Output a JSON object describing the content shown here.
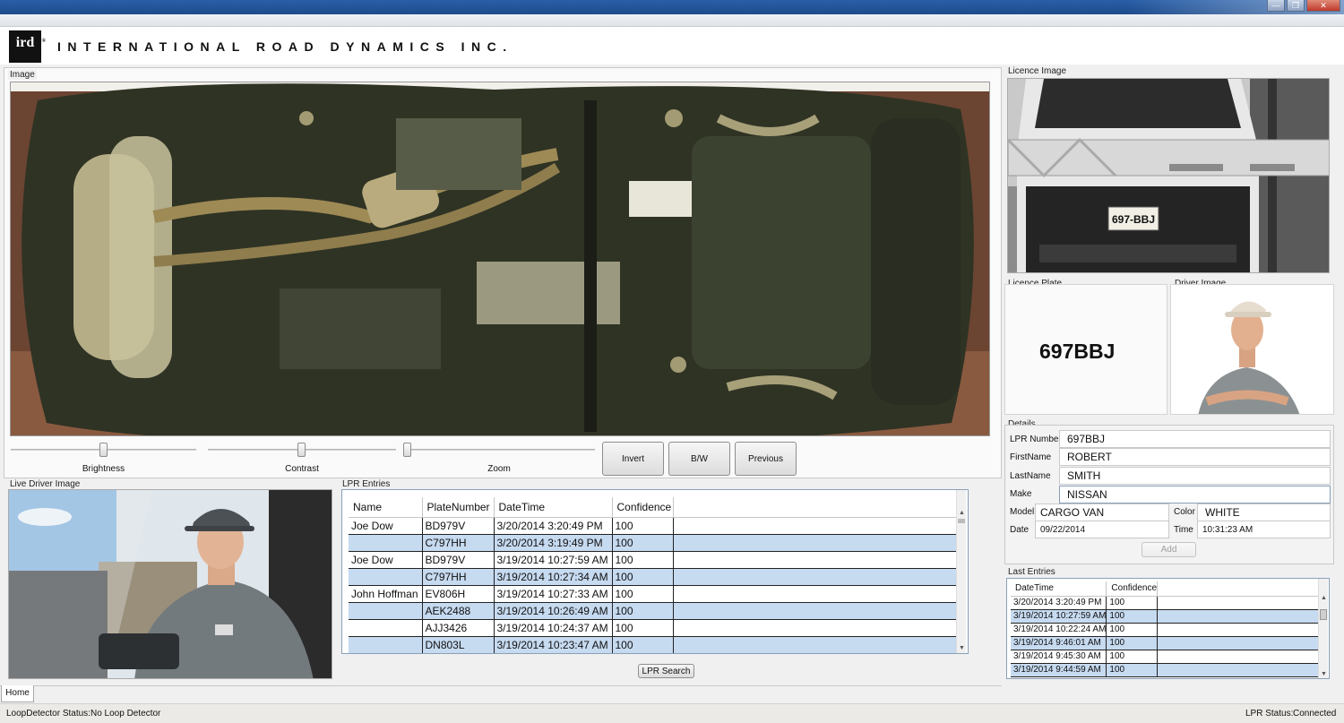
{
  "window": {
    "min": "—",
    "max": "❐",
    "close": "✕"
  },
  "header": {
    "logo_text": "ird",
    "logo_reg": "®",
    "company": "INTERNATIONAL ROAD DYNAMICS INC."
  },
  "image_panel": {
    "label": "Image"
  },
  "controls": {
    "brightness_label": "Brightness",
    "contrast_label": "Contrast",
    "zoom_label": "Zoom",
    "brightness_value": 0.5,
    "contrast_value": 0.5,
    "zoom_value": 0.0,
    "invert_label": "Invert",
    "bw_label": "B/W",
    "previous_label": "Previous"
  },
  "live_driver": {
    "label": "Live Driver Image"
  },
  "lpr_entries": {
    "label": "LPR Entries",
    "columns": [
      "Name",
      "PlateNumber",
      "DateTime",
      "Confidence"
    ],
    "rows": [
      [
        "Joe Dow",
        "BD979V",
        "3/20/2014 3:20:49 PM",
        "100"
      ],
      [
        "",
        "C797HH",
        "3/20/2014 3:19:49 PM",
        "100"
      ],
      [
        "Joe Dow",
        "BD979V",
        "3/19/2014 10:27:59 AM",
        "100"
      ],
      [
        "",
        "C797HH",
        "3/19/2014 10:27:34 AM",
        "100"
      ],
      [
        "John Hoffman",
        "EV806H",
        "3/19/2014 10:27:33 AM",
        "100"
      ],
      [
        "",
        "AEK2488",
        "3/19/2014 10:26:49 AM",
        "100"
      ],
      [
        "",
        "AJJ3426",
        "3/19/2014 10:24:37 AM",
        "100"
      ],
      [
        "",
        "DN803L",
        "3/19/2014 10:23:47 AM",
        "100"
      ]
    ],
    "search_label": "LPR Search"
  },
  "licence_image": {
    "label": "Licence Image",
    "plate_on_vehicle": "697-BBJ"
  },
  "licence_plate": {
    "label": "Licence Plate",
    "value": "697BBJ"
  },
  "driver_image": {
    "label": "Driver Image"
  },
  "details": {
    "label": "Details",
    "lpr_number_label": "LPR Number",
    "lpr_number": "697BBJ",
    "first_name_label": "FirstName",
    "first_name": "ROBERT",
    "last_name_label": "LastName",
    "last_name": "SMITH",
    "make_label": "Make",
    "make": "NISSAN",
    "model_label": "Model",
    "model": "CARGO VAN",
    "color_label": "Color",
    "color": "WHITE",
    "date_label": "Date",
    "date": "09/22/2014",
    "time_label": "Time",
    "time": "10:31:23 AM",
    "add_label": "Add"
  },
  "last_entries": {
    "label": "Last Entries",
    "columns": [
      "DateTime",
      "Confidence"
    ],
    "rows": [
      [
        "3/20/2014 3:20:49 PM",
        "100"
      ],
      [
        "3/19/2014 10:27:59 AM",
        "100"
      ],
      [
        "3/19/2014 10:22:24 AM",
        "100"
      ],
      [
        "3/19/2014 9:46:01 AM",
        "100"
      ],
      [
        "3/19/2014 9:45:30 AM",
        "100"
      ],
      [
        "3/19/2014 9:44:59 AM",
        "100"
      ]
    ]
  },
  "tabs": {
    "home": "Home"
  },
  "status": {
    "loop_label": "LoopDetector Status:",
    "loop_value": "No Loop Detector",
    "lpr_label": "LPR Status:",
    "lpr_value": "Connected"
  },
  "colors": {
    "title_bar": "#1d4b8c",
    "row_highlight": "#c6daf0"
  }
}
